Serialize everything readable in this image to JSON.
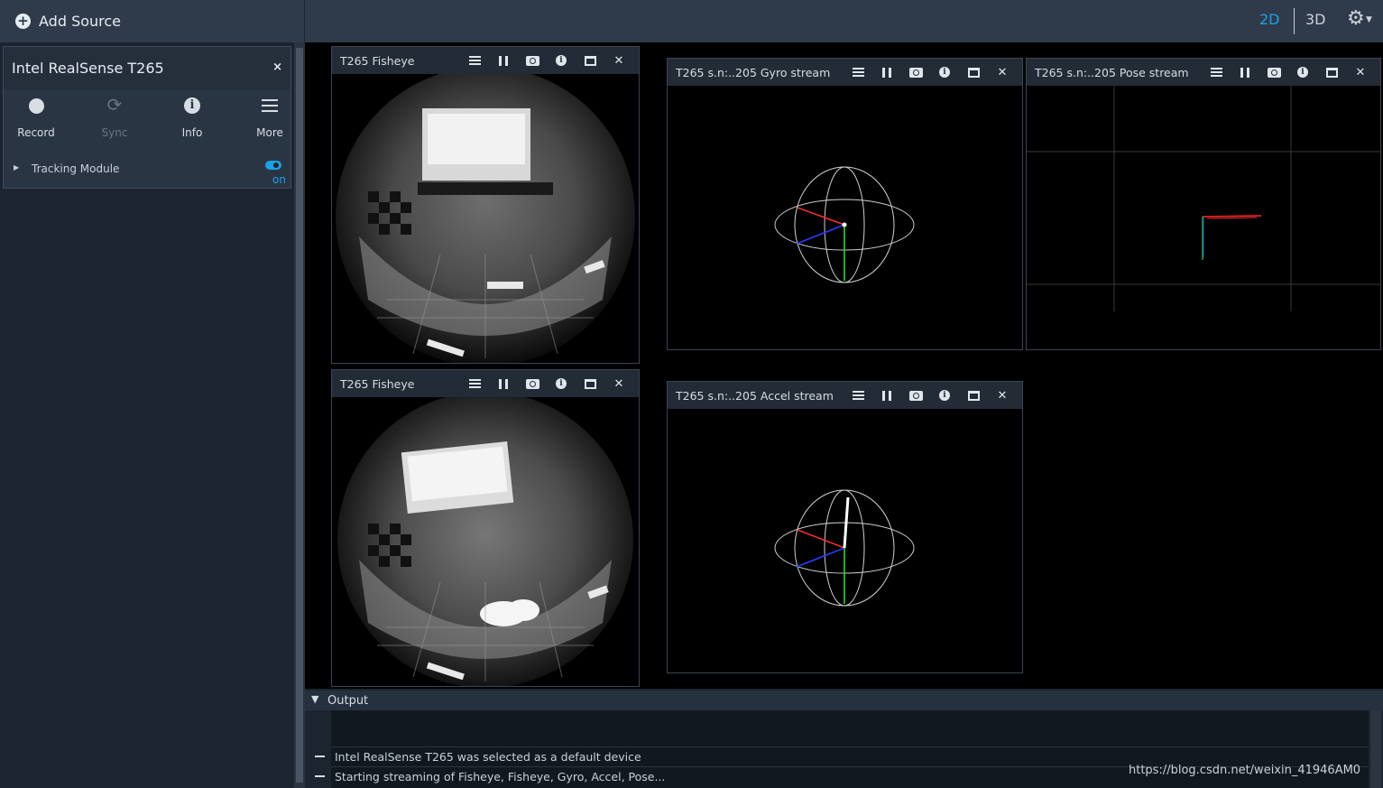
{
  "topbar": {
    "add_source_label": "Add Source",
    "view_2d": "2D",
    "view_3d": "3D",
    "accent_color": "#1ca0e6"
  },
  "device": {
    "name": "Intel RealSense T265",
    "close_glyph": "×",
    "actions": [
      {
        "label": "Record",
        "icon": "record-icon",
        "enabled": true
      },
      {
        "label": "Sync",
        "icon": "sync-icon",
        "enabled": false
      },
      {
        "label": "Info",
        "icon": "info-icon",
        "enabled": true
      },
      {
        "label": "More",
        "icon": "menu-icon",
        "enabled": true
      }
    ],
    "module": {
      "label": "Tracking Module",
      "state": "on"
    }
  },
  "streams": {
    "fisheye1": {
      "title": "T265 Fisheye"
    },
    "fisheye2": {
      "title": "T265 Fisheye"
    },
    "gyro": {
      "title": "T265 s.n:..205 Gyro stream"
    },
    "accel": {
      "title": "T265 s.n:..205 Accel stream"
    },
    "pose": {
      "title": "T265 s.n:..205 Pose stream"
    }
  },
  "stream_tools": [
    "controls-icon",
    "pause-icon",
    "snapshot-icon",
    "info-icon",
    "maximize-icon",
    "close-icon"
  ],
  "output": {
    "title": "Output",
    "lines": [
      "Intel RealSense T265 was selected as a default device",
      "Starting streaming of Fisheye, Fisheye, Gyro, Accel, Pose..."
    ]
  },
  "watermark": "https://blog.csdn.net/weixin_41946AM0"
}
